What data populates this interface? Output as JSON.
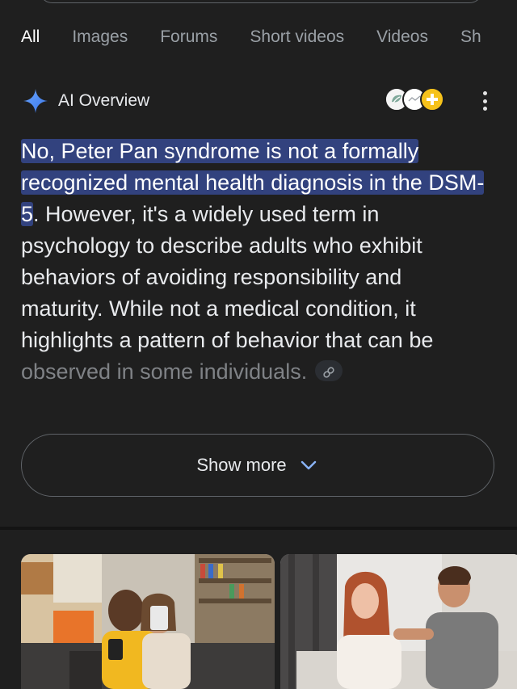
{
  "tabs": [
    {
      "label": "All",
      "active": true
    },
    {
      "label": "Images",
      "active": false
    },
    {
      "label": "Forums",
      "active": false
    },
    {
      "label": "Short videos",
      "active": false
    },
    {
      "label": "Videos",
      "active": false
    },
    {
      "label": "Sh",
      "active": false
    }
  ],
  "ai_overview": {
    "title": "AI Overview",
    "highlighted_text": "No, Peter Pan syndrome is not a formally recognized mental health diagnosis in the DSM-5",
    "body_text": ". However, it's a widely used term in psychology to describe adults who exhibit behaviors of avoiding responsibility and maturity. While not a medical condition, it highlights a pattern of behavior that can be ",
    "faded_text": "observed in some individuals.",
    "show_more_label": "Show more"
  },
  "icons": {
    "sparkle": "gemini-sparkle-icon",
    "more": "more-vert-icon",
    "link": "link-icon",
    "chevron": "chevron-down-icon"
  },
  "colors": {
    "background": "#1f1f1f",
    "highlight": "#32427e",
    "sparkle_blue": "#4a8bf5"
  }
}
